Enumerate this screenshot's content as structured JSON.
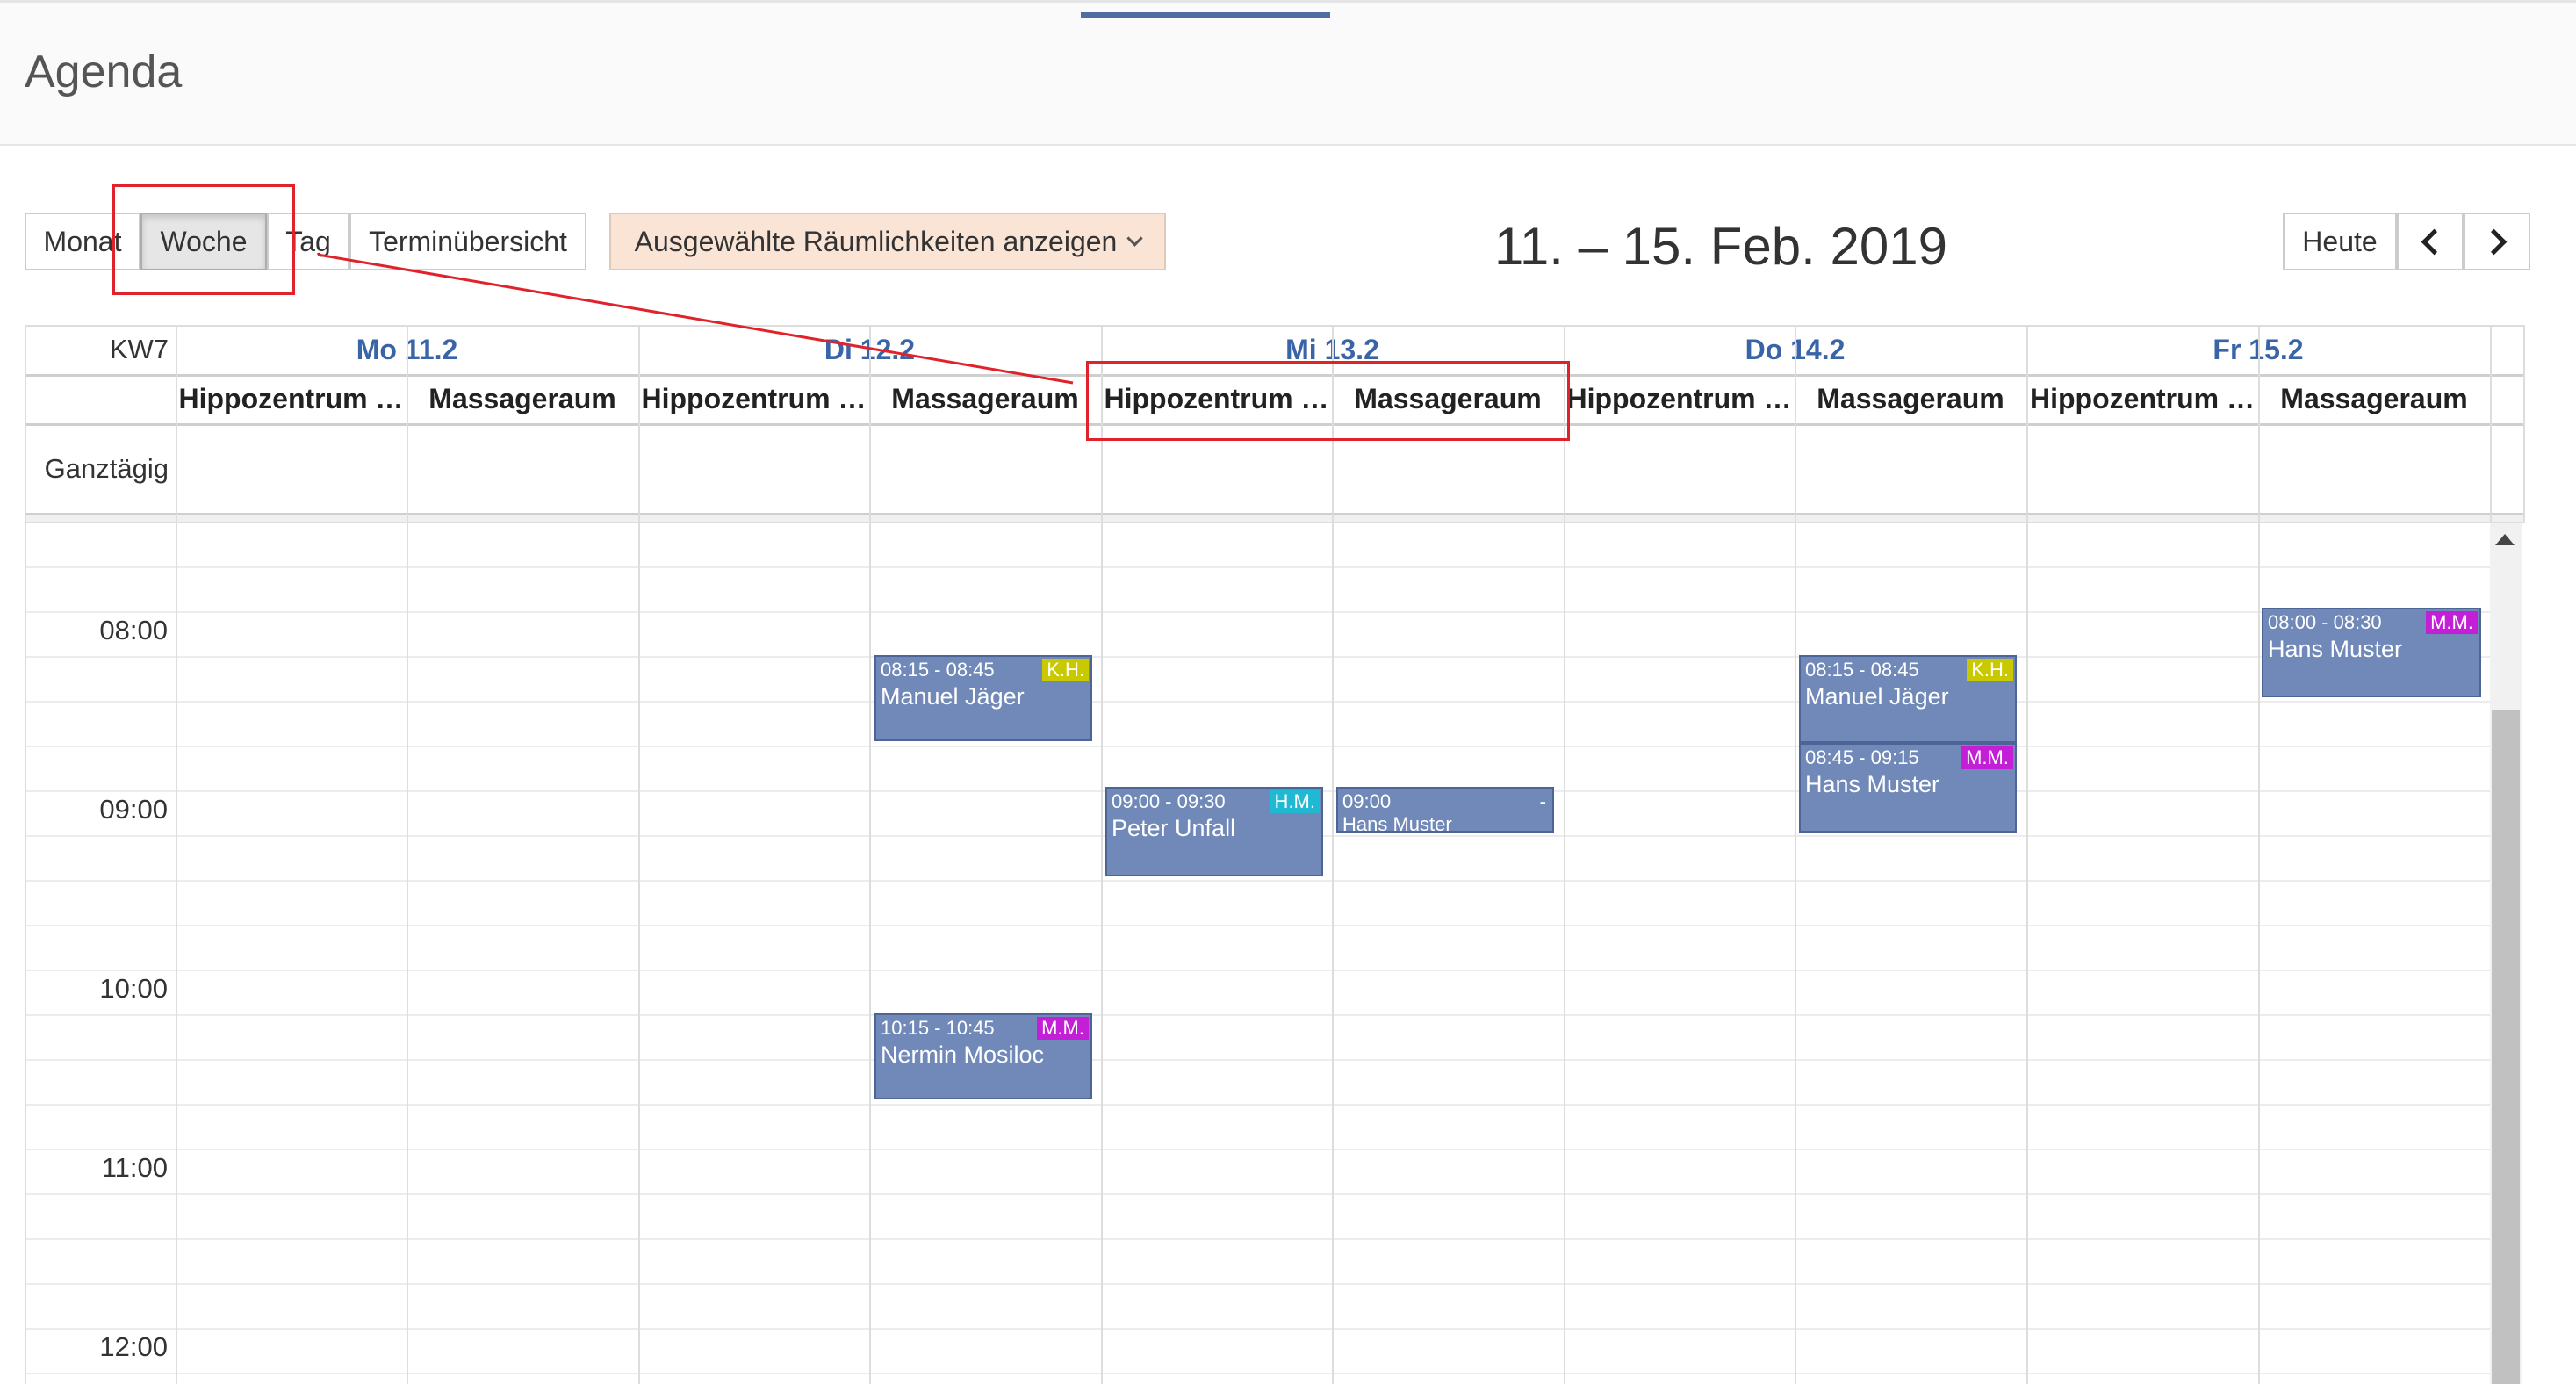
{
  "page": {
    "title": "Agenda"
  },
  "toolbar": {
    "views": [
      "Monat",
      "Woche",
      "Tag",
      "Terminübersicht"
    ],
    "active_view": "Woche",
    "rooms_button": "Ausgewählte Räumlichkeiten anzeigen",
    "today_button": "Heute",
    "date_range": "11. – 15. Feb. 2019"
  },
  "calendar": {
    "week_label": "KW7",
    "allday_label": "Ganztägig",
    "days": [
      "Mo 11.2",
      "Di 12.2",
      "Mi 13.2",
      "Do 14.2",
      "Fr 15.2"
    ],
    "rooms": [
      "Hippozentrum …",
      "Massageraum"
    ],
    "times": [
      "08:00",
      "09:00",
      "10:00",
      "11:00",
      "12:00"
    ],
    "events": [
      {
        "day": 1,
        "room": 1,
        "time": "08:15 - 08:45",
        "name": "Manuel Jäger",
        "badge": "K.H.",
        "badge_color": "#c9c900"
      },
      {
        "day": 1,
        "room": 1,
        "time": "10:15 - 10:45",
        "name": "Nermin Mosiloc",
        "badge": "M.M.",
        "badge_color": "#c21fd6"
      },
      {
        "day": 2,
        "room": 0,
        "time": "09:00 - 09:30",
        "name": "Peter Unfall",
        "badge": "H.M.",
        "badge_color": "#1fb9d3"
      },
      {
        "day": 2,
        "room": 1,
        "time": "09:00",
        "name": "Hans Muster",
        "badge": "-",
        "badge_color": ""
      },
      {
        "day": 3,
        "room": 1,
        "time": "08:15 - 08:45",
        "name": "Manuel Jäger",
        "badge": "K.H.",
        "badge_color": "#c9c900"
      },
      {
        "day": 3,
        "room": 1,
        "time": "08:45 - 09:15",
        "name": "Hans Muster",
        "badge": "M.M.",
        "badge_color": "#c21fd6"
      },
      {
        "day": 4,
        "room": 1,
        "time": "08:00 - 08:30",
        "name": "Hans Muster",
        "badge": "M.M.",
        "badge_color": "#c21fd6"
      }
    ]
  },
  "colors": {
    "accent": "#3a64a8",
    "event": "#7089b8",
    "annotation": "#e0232b"
  },
  "icons": [
    "chevron-down-icon",
    "chevron-left-icon",
    "chevron-right-icon",
    "scroll-up-icon"
  ]
}
